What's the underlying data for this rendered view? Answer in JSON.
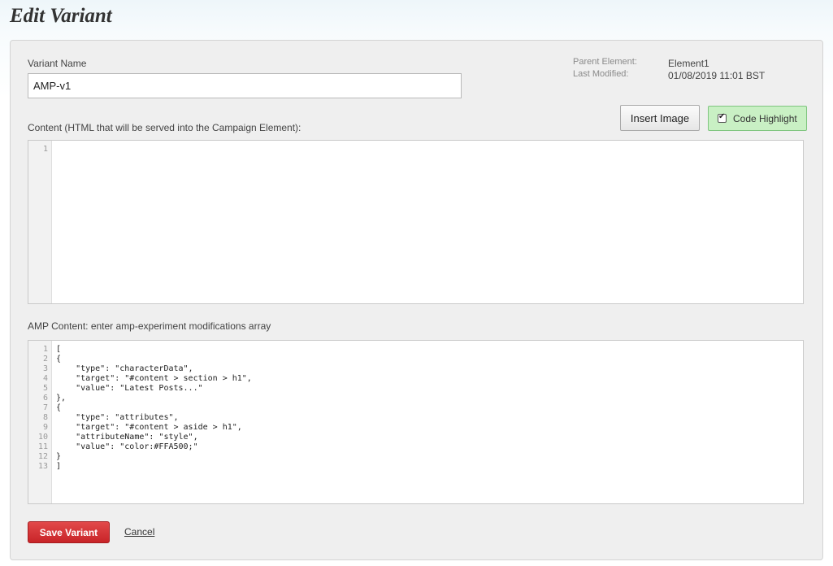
{
  "page": {
    "title": "Edit Variant"
  },
  "form": {
    "variant_name_label": "Variant Name",
    "variant_name_value": "AMP-v1",
    "meta": {
      "parent_element_label": "Parent Element:",
      "parent_element_value": "Element1",
      "last_modified_label": "Last Modified:",
      "last_modified_value": "01/08/2019 11:01 BST"
    },
    "insert_image_label": "Insert Image",
    "code_highlight_label": "Code Highlight",
    "code_highlight_checked": true,
    "content_label": "Content (HTML that will be served into the Campaign Element):",
    "content_lines": [
      "1"
    ],
    "content_code": "",
    "amp_label": "AMP Content: enter amp-experiment modifications array",
    "amp_lines": [
      "1",
      "2",
      "3",
      "4",
      "5",
      "6",
      "7",
      "8",
      "9",
      "10",
      "11",
      "12",
      "13"
    ],
    "amp_code": [
      "[",
      "{",
      "    \"type\": \"characterData\",",
      "    \"target\": \"#content > section > h1\",",
      "    \"value\": \"Latest Posts...\"",
      "},",
      "{",
      "    \"type\": \"attributes\",",
      "    \"target\": \"#content > aside > h1\",",
      "    \"attributeName\": \"style\",",
      "    \"value\": \"color:#FFA500;\"",
      "}",
      "]"
    ],
    "save_label": "Save Variant",
    "cancel_label": "Cancel"
  },
  "colors": {
    "save_button": "#d9373a",
    "code_highlight_bg": "#c9f0c4",
    "panel_bg": "#efefef"
  }
}
